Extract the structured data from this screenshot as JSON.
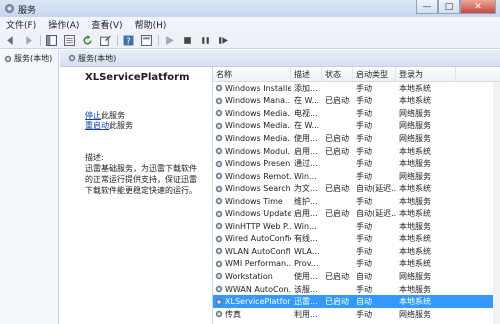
{
  "window": {
    "title": "服务",
    "min_label": "—",
    "max_label": "□",
    "close_label": "✕"
  },
  "menu": [
    "文件(F)",
    "操作(A)",
    "查看(V)",
    "帮助(H)"
  ],
  "toolbar": [
    "back-icon",
    "forward-icon",
    "console-tree-icon",
    "properties-icon",
    "refresh-icon",
    "export-icon",
    "help-icon",
    "properties-sheet-icon",
    "play-icon",
    "stop-icon",
    "pause-icon",
    "restart-icon"
  ],
  "left": {
    "node_label": "服务(本地)"
  },
  "panel": {
    "header": "服务(本地)"
  },
  "details": {
    "service_name": "XLServicePlatform",
    "action1_link": "停止",
    "action1_suffix": "此服务",
    "action2_link": "重启动",
    "action2_suffix": "此服务",
    "desc_label": "描述:",
    "desc_text": "迅雷基础服务，为迅雷下载软件的正常运行提供支持，保证迅雷下载软件能更稳定快速的运行。"
  },
  "columns": [
    "名称",
    "描述",
    "状态",
    "启动类型",
    "登录为"
  ],
  "rows": [
    {
      "name": "Windows Installer",
      "desc": "添加...",
      "status": "",
      "start": "手动",
      "logon": "本地系统"
    },
    {
      "name": "Windows Mana...",
      "desc": "在 W...",
      "status": "已启动",
      "start": "手动",
      "logon": "本地系统"
    },
    {
      "name": "Windows Media...",
      "desc": "电视...",
      "status": "",
      "start": "手动",
      "logon": "网络服务"
    },
    {
      "name": "Windows Media...",
      "desc": "在 W...",
      "status": "",
      "start": "手动",
      "logon": "网络服务"
    },
    {
      "name": "Windows Media...",
      "desc": "使用...",
      "status": "已启动",
      "start": "手动",
      "logon": "网络服务"
    },
    {
      "name": "Windows Modul...",
      "desc": "启用...",
      "status": "已启动",
      "start": "手动",
      "logon": "本地系统"
    },
    {
      "name": "Windows Presen...",
      "desc": "通过...",
      "status": "",
      "start": "手动",
      "logon": "本地服务"
    },
    {
      "name": "Windows Remot...",
      "desc": "Win...",
      "status": "",
      "start": "手动",
      "logon": "网络服务"
    },
    {
      "name": "Windows Search",
      "desc": "为文...",
      "status": "已启动",
      "start": "自动(延迟...",
      "logon": "本地系统"
    },
    {
      "name": "Windows Time",
      "desc": "维护...",
      "status": "",
      "start": "手动",
      "logon": "本地服务"
    },
    {
      "name": "Windows Update",
      "desc": "启用...",
      "status": "已启动",
      "start": "自动(延迟...",
      "logon": "本地系统"
    },
    {
      "name": "WinHTTP Web P...",
      "desc": "Win...",
      "status": "",
      "start": "手动",
      "logon": "本地服务"
    },
    {
      "name": "Wired AutoConfig",
      "desc": "有线...",
      "status": "",
      "start": "手动",
      "logon": "本地系统"
    },
    {
      "name": "WLAN AutoConfig",
      "desc": "WLA...",
      "status": "",
      "start": "手动",
      "logon": "本地系统"
    },
    {
      "name": "WMI Performan...",
      "desc": "Prov...",
      "status": "",
      "start": "手动",
      "logon": "本地系统"
    },
    {
      "name": "Workstation",
      "desc": "使用...",
      "status": "已启动",
      "start": "自动",
      "logon": "网络服务"
    },
    {
      "name": "WWAN AutoCon...",
      "desc": "该服...",
      "status": "",
      "start": "手动",
      "logon": "本地服务"
    },
    {
      "name": "XLServicePlatform",
      "desc": "迅雷...",
      "status": "已启动",
      "start": "自动",
      "logon": "本地系统",
      "selected": true
    },
    {
      "name": "传真",
      "desc": "利用...",
      "status": "",
      "start": "手动",
      "logon": "网络服务"
    }
  ],
  "colors": {
    "selection": "#3399ff",
    "link": "#0645ad",
    "titlebar": "#c5d6ee"
  }
}
